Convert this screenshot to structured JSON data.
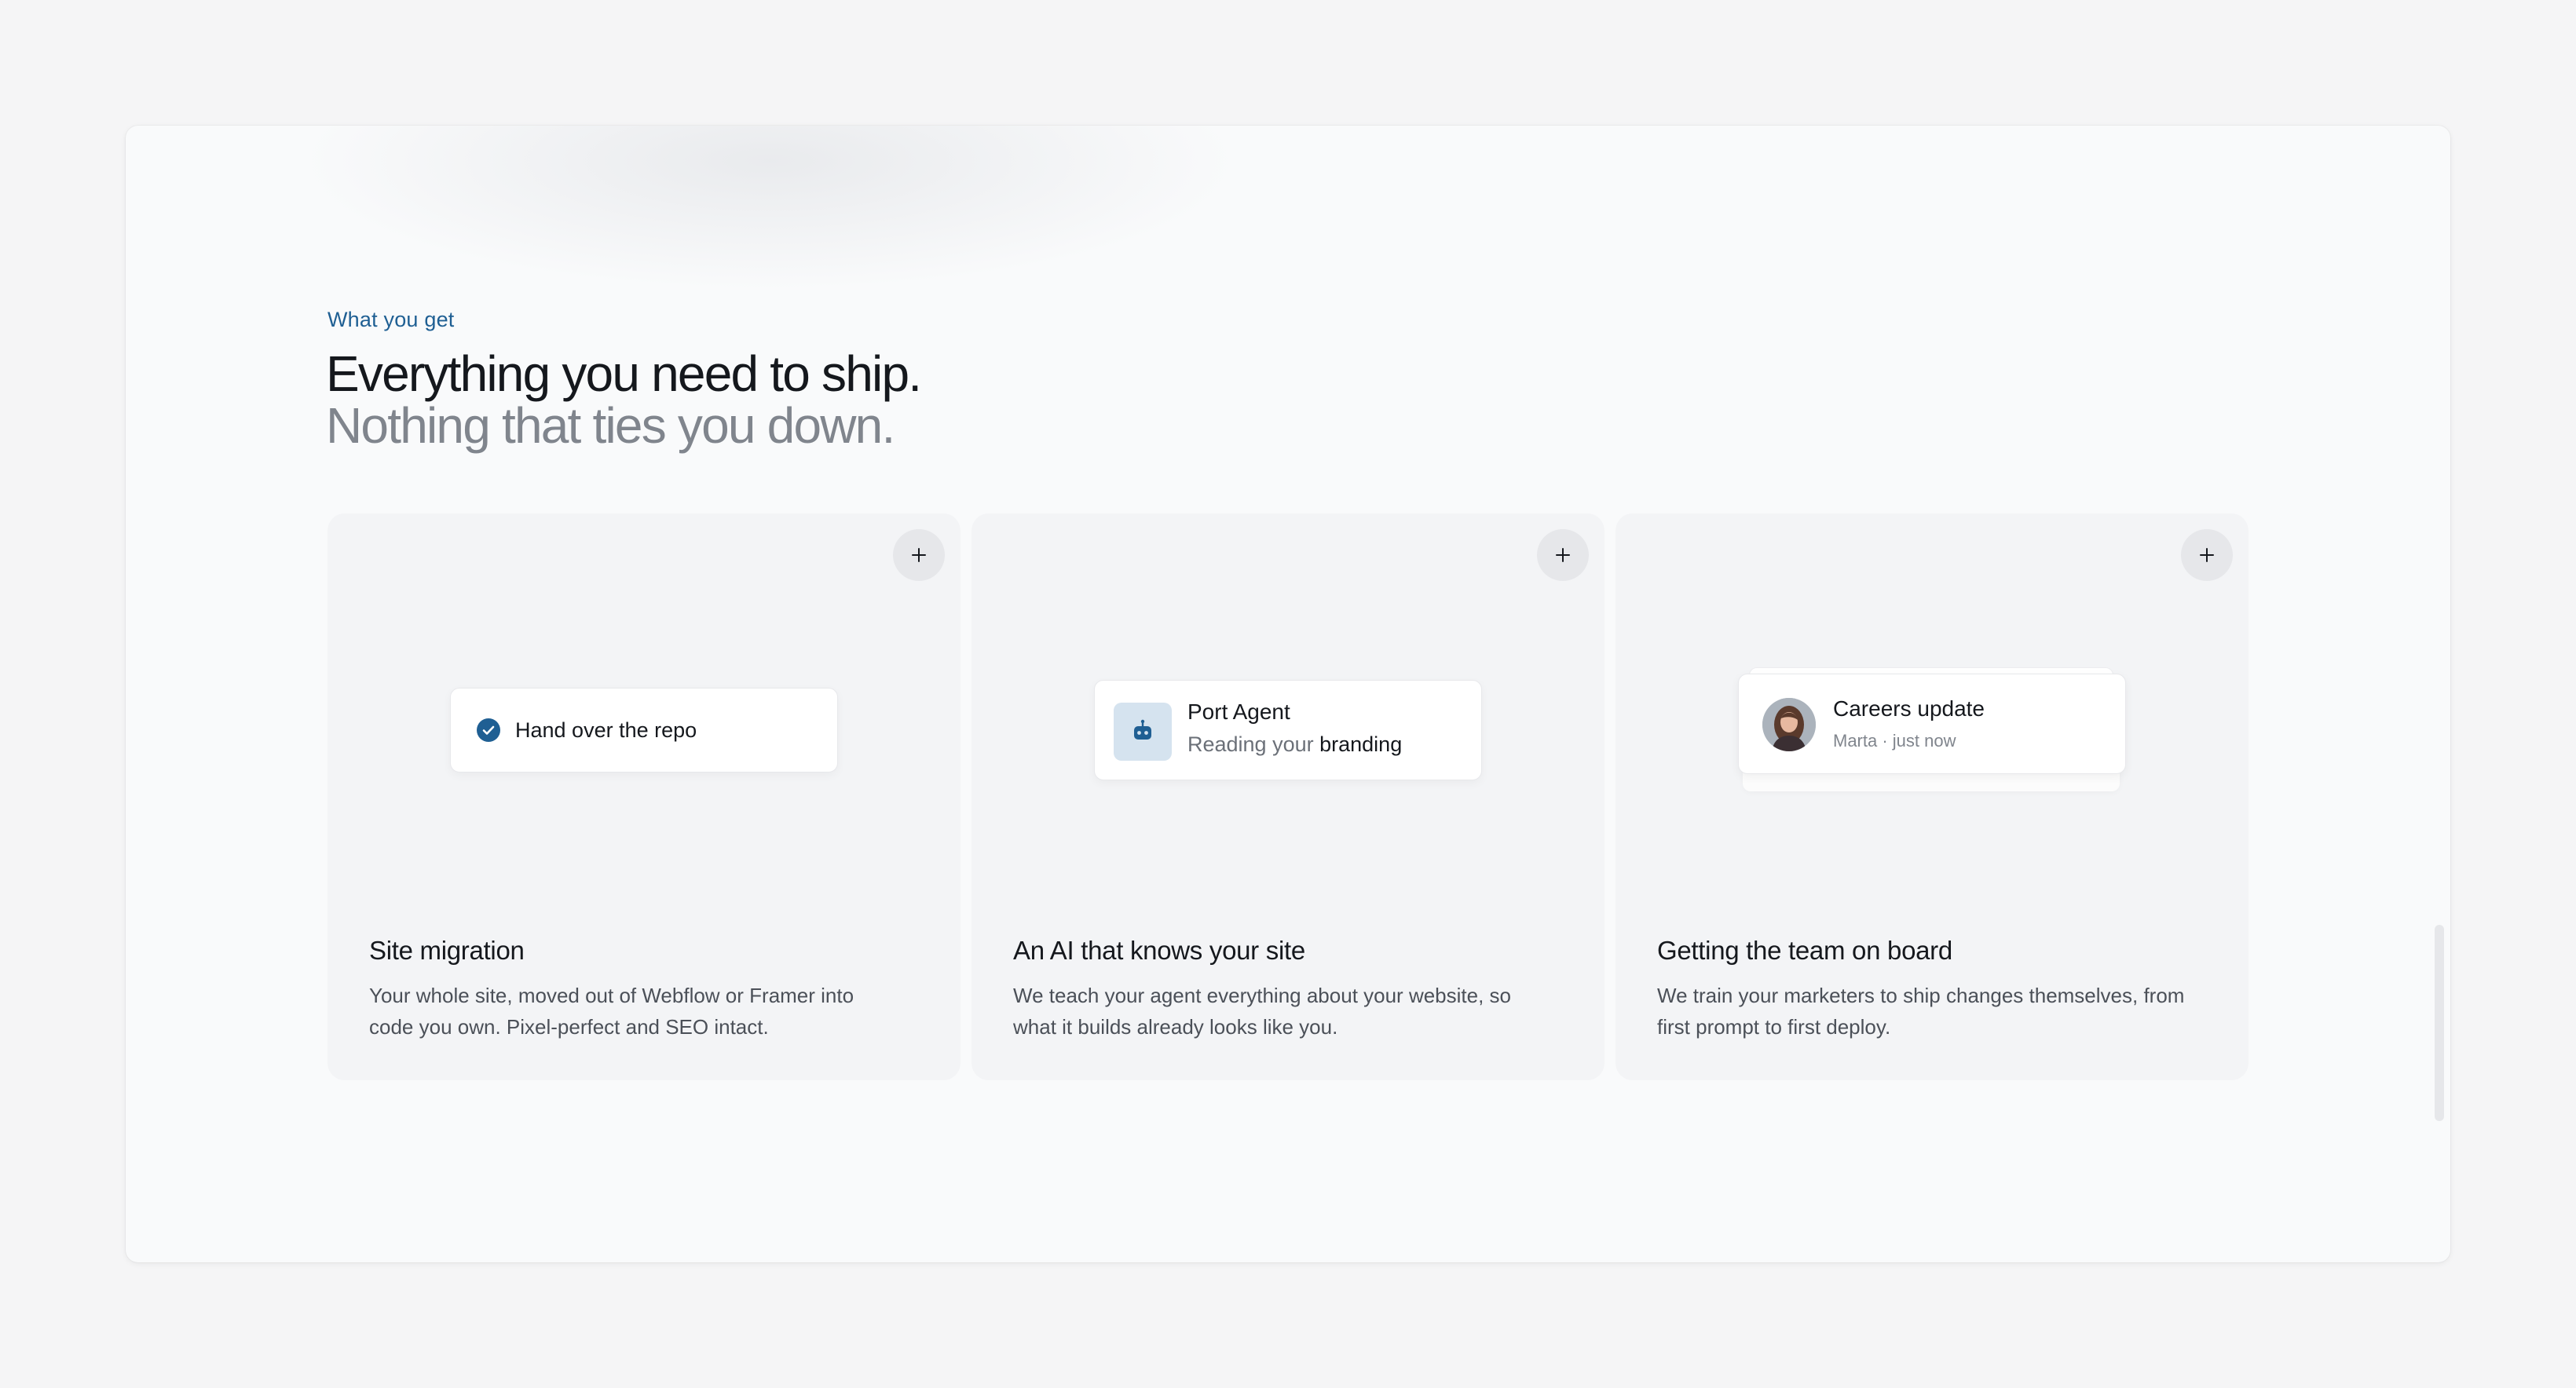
{
  "section": {
    "eyebrow": "What you get",
    "headline": "Everything you need to ship.",
    "subheadline": "Nothing that ties you down."
  },
  "cards": [
    {
      "title": "Site migration",
      "description": "Your whole site, moved out of Webflow or Framer into code you own. Pixel-perfect and SEO intact.",
      "widget": {
        "icon": "check-circle-icon",
        "label": "Hand over the repo"
      },
      "expand_icon": "plus-icon"
    },
    {
      "title": "An AI that knows your site",
      "description": "We teach your agent everything about your website, so what it builds already looks like you.",
      "widget": {
        "icon": "robot-icon",
        "name": "Port Agent",
        "status_prefix": "Reading your",
        "status_highlight": "branding"
      },
      "expand_icon": "plus-icon"
    },
    {
      "title": "Getting the team on board",
      "description": "We train your marketers to ship changes themselves, from first prompt to first deploy.",
      "widget": {
        "avatar": "avatar-photo",
        "title": "Careers update",
        "meta": "Marta · just now"
      },
      "expand_icon": "plus-icon"
    }
  ],
  "colors": {
    "accent": "#1f5f93",
    "page_bg": "#f5f5f6",
    "card_bg": "#f3f4f6",
    "heading": "#15181d",
    "muted": "#80858d"
  }
}
